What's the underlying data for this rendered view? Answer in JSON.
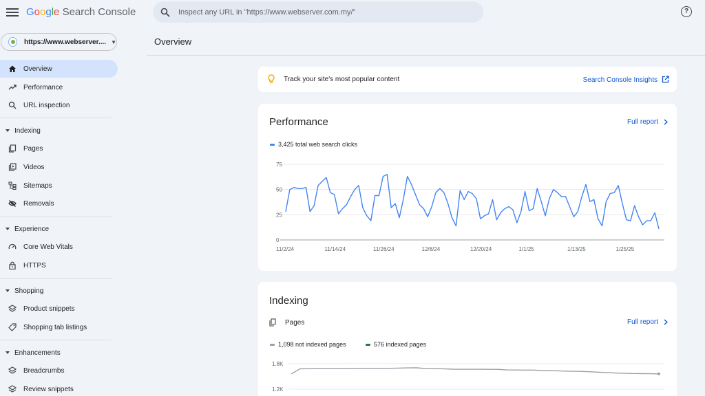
{
  "app": {
    "logo_letters": [
      "G",
      "o",
      "o",
      "g",
      "l",
      "e"
    ],
    "product": "Search Console",
    "search_placeholder": "Inspect any URL in \"https://www.webserver.com.my/\"",
    "help_icon": "?"
  },
  "sidebar": {
    "property": "https://www.webserver....",
    "items": [
      {
        "label": "Overview",
        "icon": "home-icon",
        "active": true
      },
      {
        "label": "Performance",
        "icon": "trending-up-icon"
      },
      {
        "label": "URL inspection",
        "icon": "search-icon"
      }
    ],
    "sections": [
      {
        "label": "Indexing",
        "items": [
          {
            "label": "Pages",
            "icon": "pages-icon"
          },
          {
            "label": "Videos",
            "icon": "video-icon"
          },
          {
            "label": "Sitemaps",
            "icon": "sitemap-icon"
          },
          {
            "label": "Removals",
            "icon": "eye-off-icon"
          }
        ]
      },
      {
        "label": "Experience",
        "items": [
          {
            "label": "Core Web Vitals",
            "icon": "gauge-icon"
          },
          {
            "label": "HTTPS",
            "icon": "lock-icon"
          }
        ]
      },
      {
        "label": "Shopping",
        "items": [
          {
            "label": "Product snippets",
            "icon": "layers-icon"
          },
          {
            "label": "Shopping tab listings",
            "icon": "tag-icon"
          }
        ]
      },
      {
        "label": "Enhancements",
        "items": [
          {
            "label": "Breadcrumbs",
            "icon": "layers-icon"
          },
          {
            "label": "Review snippets",
            "icon": "layers-icon"
          }
        ]
      }
    ]
  },
  "main": {
    "title": "Overview",
    "insights": {
      "text": "Track your site's most popular content",
      "link": "Search Console Insights"
    },
    "performance": {
      "title": "Performance",
      "full_report": "Full report",
      "legend": "3,425 total web search clicks"
    },
    "indexing": {
      "title": "Indexing",
      "pages_label": "Pages",
      "full_report": "Full report",
      "legend_not_indexed": "1,098 not indexed pages",
      "legend_indexed": "576 indexed pages"
    }
  },
  "colors": {
    "accent": "#0b57d0",
    "clicks_line": "#4285f4",
    "not_indexed": "#9aa0a6",
    "indexed": "#188038",
    "active_nav": "#d3e3fd"
  },
  "chart_data": [
    {
      "type": "line",
      "series": [
        {
          "name": "3,425 total web search clicks",
          "values": [
            28,
            50,
            52,
            51,
            51,
            52,
            28,
            34,
            54,
            58,
            62,
            47,
            45,
            26,
            31,
            35,
            43,
            50,
            54,
            32,
            24,
            19,
            44,
            44,
            63,
            65,
            32,
            36,
            22,
            40,
            63,
            55,
            45,
            35,
            31,
            23,
            33,
            47,
            51,
            47,
            36,
            22,
            14,
            49,
            40,
            48,
            46,
            41,
            21,
            24,
            26,
            40,
            20,
            27,
            31,
            33,
            30,
            17,
            28,
            48,
            29,
            31,
            51,
            38,
            24,
            41,
            50,
            47,
            43,
            43,
            33,
            23,
            28,
            43,
            55,
            38,
            40,
            21,
            14,
            38,
            46,
            47,
            54,
            36,
            20,
            19,
            34,
            23,
            15,
            19,
            19,
            27,
            11
          ]
        }
      ],
      "x_tick_labels": [
        "11/2/24",
        "11/14/24",
        "11/26/24",
        "12/8/24",
        "12/20/24",
        "1/1/25",
        "1/13/25",
        "1/25/25"
      ],
      "y_ticks": [
        0,
        25,
        50,
        75
      ],
      "ylim": [
        0,
        75
      ],
      "grid": true
    },
    {
      "type": "line",
      "series": [
        {
          "name": "1,098 not indexed pages",
          "values": [
            1560,
            1680,
            1681,
            1682,
            1682,
            1683,
            1683,
            1688,
            1690,
            1689,
            1691,
            1692,
            1697,
            1701,
            1703,
            1685,
            1682,
            1680,
            1670,
            1669,
            1668,
            1668,
            1667,
            1667,
            1652,
            1651,
            1650,
            1650,
            1640,
            1640,
            1628,
            1623,
            1620,
            1612,
            1602,
            1592,
            1583,
            1574,
            1568,
            1566,
            1563,
            1560
          ]
        }
      ],
      "y_tick_labels": [
        "1.8K",
        "1.2K"
      ],
      "y_ticks": [
        1800,
        1200
      ],
      "ylim": [
        1200,
        1800
      ],
      "grid": true
    }
  ]
}
